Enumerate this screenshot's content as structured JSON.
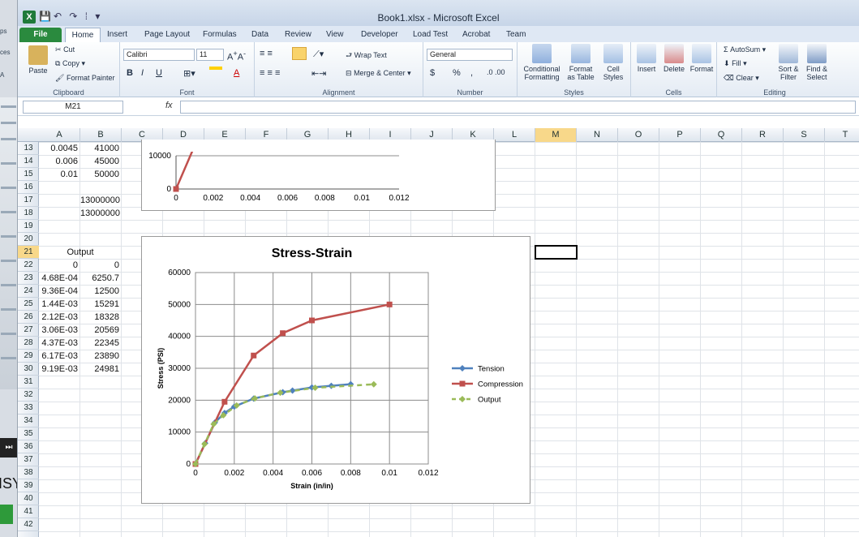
{
  "window": {
    "title": "Book1.xlsx - Microsoft Excel",
    "app_icon": "X"
  },
  "tabs": [
    "File",
    "Home",
    "Insert",
    "Page Layout",
    "Formulas",
    "Data",
    "Review",
    "View",
    "Developer",
    "Load Test",
    "Acrobat",
    "Team"
  ],
  "ribbon": {
    "clipboard": {
      "label": "Clipboard",
      "paste": "Paste",
      "cut": "Cut",
      "copy": "Copy",
      "format_painter": "Format Painter"
    },
    "font": {
      "label": "Font",
      "name": "Calibri",
      "size": "11",
      "bold": "B",
      "italic": "I",
      "underline": "U"
    },
    "alignment": {
      "label": "Alignment",
      "wrap": "Wrap Text",
      "merge": "Merge & Center"
    },
    "number": {
      "label": "Number",
      "format": "General",
      "currency": "$",
      "percent": "%",
      "comma": ","
    },
    "styles": {
      "label": "Styles",
      "conditional": "Conditional Formatting",
      "format_table": "Format as Table",
      "cell_styles": "Cell Styles"
    },
    "cells": {
      "label": "Cells",
      "insert": "Insert",
      "delete": "Delete",
      "format": "Format"
    },
    "editing": {
      "label": "Editing",
      "autosum": "AutoSum",
      "fill": "Fill",
      "clear": "Clear",
      "sort": "Sort & Filter",
      "find": "Find & Select"
    }
  },
  "formula_bar": {
    "name_box": "M21",
    "fx": "fx",
    "value": ""
  },
  "columns": [
    "A",
    "B",
    "C",
    "D",
    "E",
    "F",
    "G",
    "H",
    "I",
    "J",
    "K",
    "L",
    "M",
    "N",
    "O",
    "P",
    "Q",
    "R",
    "S",
    "T"
  ],
  "selected_column": "M",
  "rows": [
    "13",
    "14",
    "15",
    "16",
    "17",
    "18",
    "19",
    "20",
    "21",
    "22",
    "23",
    "24",
    "25",
    "26",
    "27",
    "28",
    "29",
    "30",
    "31",
    "32",
    "33",
    "34",
    "35",
    "36",
    "37",
    "38",
    "39",
    "40",
    "41",
    "42"
  ],
  "selected_row": "21",
  "cells": [
    {
      "row": 0,
      "col": "A",
      "v": "0.0045"
    },
    {
      "row": 0,
      "col": "B",
      "v": "41000"
    },
    {
      "row": 1,
      "col": "A",
      "v": "0.006"
    },
    {
      "row": 1,
      "col": "B",
      "v": "45000"
    },
    {
      "row": 2,
      "col": "A",
      "v": "0.01"
    },
    {
      "row": 2,
      "col": "B",
      "v": "50000"
    },
    {
      "row": 4,
      "col": "B",
      "v": "13000000"
    },
    {
      "row": 5,
      "col": "B",
      "v": "13000000"
    },
    {
      "row": 8,
      "col": "AB",
      "v": "Output"
    },
    {
      "row": 9,
      "col": "A",
      "v": "0"
    },
    {
      "row": 9,
      "col": "B",
      "v": "0"
    },
    {
      "row": 10,
      "col": "A",
      "v": "4.68E-04"
    },
    {
      "row": 10,
      "col": "B",
      "v": "6250.7"
    },
    {
      "row": 11,
      "col": "A",
      "v": "9.36E-04"
    },
    {
      "row": 11,
      "col": "B",
      "v": "12500"
    },
    {
      "row": 12,
      "col": "A",
      "v": "1.44E-03"
    },
    {
      "row": 12,
      "col": "B",
      "v": "15291"
    },
    {
      "row": 13,
      "col": "A",
      "v": "2.12E-03"
    },
    {
      "row": 13,
      "col": "B",
      "v": "18328"
    },
    {
      "row": 14,
      "col": "A",
      "v": "3.06E-03"
    },
    {
      "row": 14,
      "col": "B",
      "v": "20569"
    },
    {
      "row": 15,
      "col": "A",
      "v": "4.37E-03"
    },
    {
      "row": 15,
      "col": "B",
      "v": "22345"
    },
    {
      "row": 16,
      "col": "A",
      "v": "6.17E-03"
    },
    {
      "row": 16,
      "col": "B",
      "v": "23890"
    },
    {
      "row": 17,
      "col": "A",
      "v": "9.19E-03"
    },
    {
      "row": 17,
      "col": "B",
      "v": "24981"
    }
  ],
  "chart_data": [
    {
      "type": "line",
      "title": "",
      "xlim": [
        0,
        0.012
      ],
      "ylim": [
        0,
        10000
      ],
      "x_ticks": [
        "0",
        "0.002",
        "0.004",
        "0.006",
        "0.008",
        "0.01",
        "0.012"
      ],
      "y_ticks": [
        "0",
        "10000"
      ],
      "series": [
        {
          "color": "#c0504d",
          "x": [
            0,
            0.001
          ],
          "y": [
            0,
            13000
          ]
        }
      ]
    },
    {
      "type": "line",
      "title": "Stress-Strain",
      "xlabel": "Strain (in/in)",
      "ylabel": "Stress (PSI)",
      "xlim": [
        0,
        0.012
      ],
      "ylim": [
        0,
        60000
      ],
      "x_ticks": [
        "0",
        "0.002",
        "0.004",
        "0.006",
        "0.008",
        "0.01",
        "0.012"
      ],
      "y_ticks": [
        "0",
        "10000",
        "20000",
        "30000",
        "40000",
        "50000",
        "60000"
      ],
      "legend": "right",
      "series": [
        {
          "name": "Tension",
          "color": "#4f81bd",
          "marker": "diamond",
          "dash": false,
          "x": [
            0,
            0.0005,
            0.001,
            0.0015,
            0.002,
            0.003,
            0.0045,
            0.005,
            0.006,
            0.007,
            0.008
          ],
          "y": [
            0,
            6500,
            13000,
            16000,
            18000,
            20500,
            22500,
            23000,
            24000,
            24500,
            25000
          ]
        },
        {
          "name": "Compression",
          "color": "#c0504d",
          "marker": "square",
          "dash": false,
          "x": [
            0,
            0.0015,
            0.003,
            0.0045,
            0.006,
            0.01
          ],
          "y": [
            0,
            19500,
            34000,
            41000,
            45000,
            50000
          ]
        },
        {
          "name": "Output",
          "color": "#9bbb59",
          "marker": "diamond",
          "dash": true,
          "x": [
            0,
            0.000468,
            0.000936,
            0.00144,
            0.00212,
            0.00306,
            0.00437,
            0.00617,
            0.00919
          ],
          "y": [
            0,
            6250.7,
            12500,
            15291,
            18328,
            20569,
            22345,
            23890,
            24981
          ]
        }
      ]
    }
  ]
}
